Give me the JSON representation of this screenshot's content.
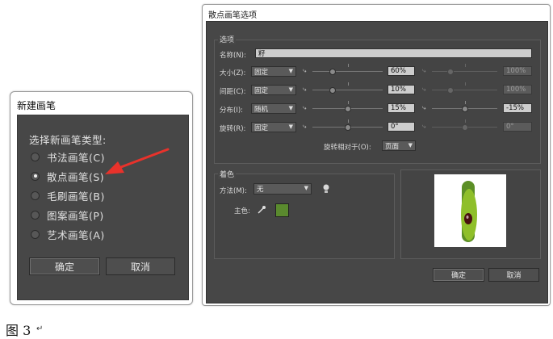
{
  "new_brush": {
    "title": "新建画笔",
    "heading": "选择新画笔类型:",
    "options": [
      {
        "label": "书法画笔(C)",
        "selected": false
      },
      {
        "label": "散点画笔(S)",
        "selected": true
      },
      {
        "label": "毛刷画笔(B)",
        "selected": false
      },
      {
        "label": "图案画笔(P)",
        "selected": false
      },
      {
        "label": "艺术画笔(A)",
        "selected": false
      }
    ],
    "ok": "确定",
    "cancel": "取消"
  },
  "scatter": {
    "title": "散点画笔选项",
    "options_group": "选项",
    "name_label": "名称(N):",
    "name_value": "籽",
    "rows": [
      {
        "label": "大小(Z):",
        "mode": "固定",
        "value": "60%",
        "value2": "100%",
        "fill": 0.29
      },
      {
        "label": "间距(C):",
        "mode": "固定",
        "value": "10%",
        "value2": "100%",
        "fill": 0.29
      },
      {
        "label": "分布(I):",
        "mode": "随机",
        "value": "15%",
        "value2": "-15%",
        "fill": 0.5
      },
      {
        "label": "旋转(R):",
        "mode": "固定",
        "value": "0°",
        "value2": "0°",
        "fill": 0.5
      }
    ],
    "rotation_rel_label": "旋转相对于(O):",
    "rotation_rel_value": "页面",
    "colorize_group": "着色",
    "method_label": "方法(M):",
    "method_value": "无",
    "key_color_label": "主色:",
    "key_color": "#5a8a2e",
    "ok": "确定",
    "cancel": "取消"
  },
  "caption": "图 3",
  "colors": {
    "accent_arrow": "#e8322b",
    "panel": "#474747"
  }
}
